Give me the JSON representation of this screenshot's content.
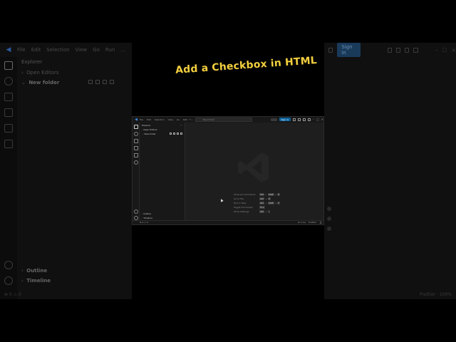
{
  "caption": "Add a Checkbox in HTML",
  "background_left": {
    "menu": [
      "File",
      "Edit",
      "Selection",
      "View",
      "Go",
      "Run",
      "..."
    ],
    "explorer_title": "Explorer",
    "open_editors": "Open Editors",
    "new_folder": "New folder",
    "outline": "Outline",
    "timeline": "Timeline",
    "status": "⊗ 0 ⚠ 0"
  },
  "background_right": {
    "sign_in": "Sign in",
    "status": "Prettier  ·  100%"
  },
  "window": {
    "menu": [
      "File",
      "Edit",
      "Selection",
      "View",
      "Go",
      "Run",
      "..."
    ],
    "search_placeholder": "New folder",
    "sign_in": "Sign in",
    "explorer_title": "Explorer",
    "open_editors": "Open Editors",
    "new_folder": "New folder",
    "outline": "Outline",
    "timeline": "Timeline",
    "shortcuts": [
      {
        "label": "Show All Commands",
        "keys": [
          "Ctrl",
          "+",
          "Shift",
          "+",
          "P"
        ]
      },
      {
        "label": "Go to File",
        "keys": [
          "Ctrl",
          "+",
          "P"
        ]
      },
      {
        "label": "Find in Files",
        "keys": [
          "Ctrl",
          "+",
          "Shift",
          "+",
          "F"
        ]
      },
      {
        "label": "Toggle Full Screen",
        "keys": [
          "F11"
        ]
      },
      {
        "label": "Show Settings",
        "keys": [
          "Ctrl",
          "+",
          ","
        ]
      }
    ],
    "status_left": "⊗ 0 ⚠ 0",
    "status_right_1": "Go Live",
    "status_right_2": "Prettier"
  },
  "colors": {
    "caption": "#f4d03f",
    "accent": "#0e639c",
    "vscode_logo": "#3b8eea"
  }
}
